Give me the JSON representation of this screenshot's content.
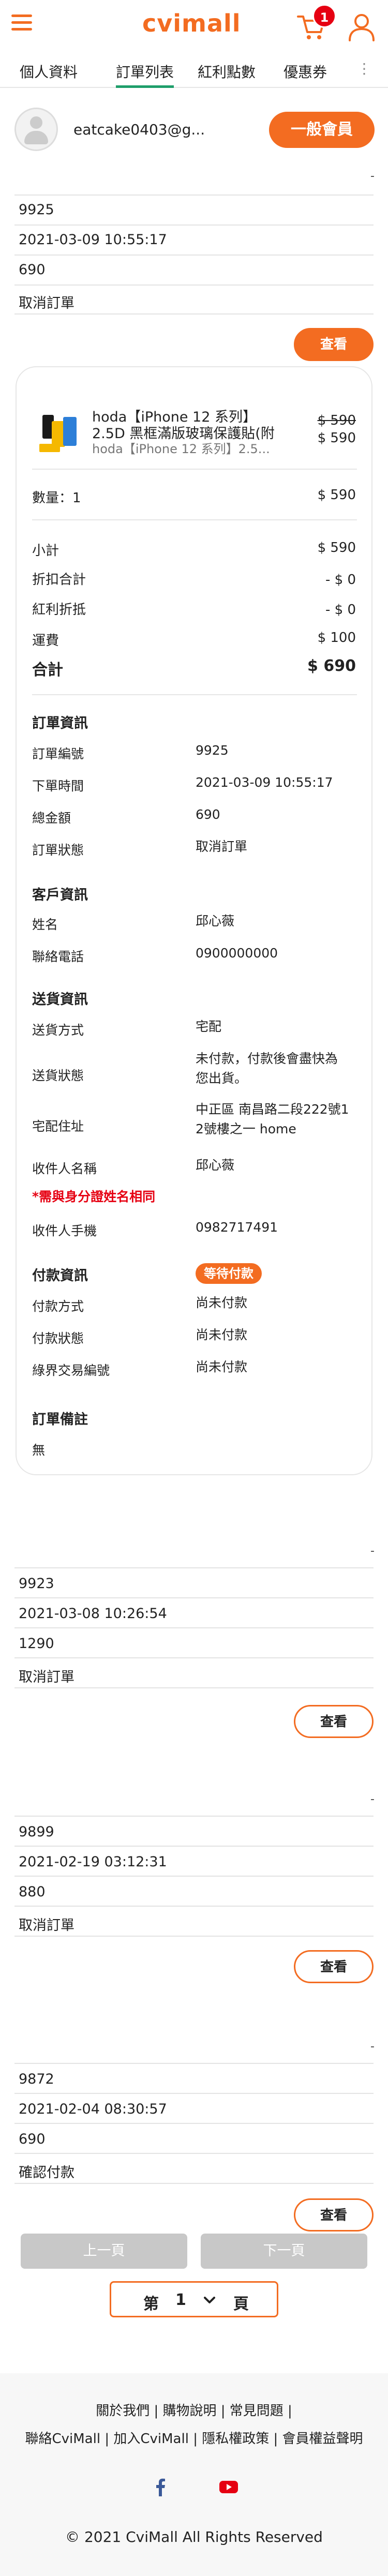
{
  "header": {
    "logo": "cvimall",
    "cart_count": "1"
  },
  "tabs": {
    "items": [
      "個人資料",
      "訂單列表",
      "紅利點數",
      "優惠券"
    ],
    "more": "⋮"
  },
  "user": {
    "email": "eatcake0403@g...",
    "member_level": "一般會員"
  },
  "orders": [
    {
      "number": "9925",
      "time": "2021-03-09 10:55:17",
      "total": "690",
      "status": "取消訂單",
      "view_label": "查看"
    },
    {
      "number": "9923",
      "time": "2021-03-08 10:26:54",
      "total": "1290",
      "status": "取消訂單",
      "view_label": "查看"
    },
    {
      "number": "9899",
      "time": "2021-02-19 03:12:31",
      "total": "880",
      "status": "取消訂單",
      "view_label": "查看"
    },
    {
      "number": "9872",
      "time": "2021-02-04 08:30:57",
      "total": "690",
      "status": "確認付款",
      "view_label": "查看"
    }
  ],
  "order_row_dash": "-",
  "detail": {
    "product": {
      "name_line1": "hoda【iPhone 12 系列】",
      "name_line2": "2.5D 黑框滿版玻璃保護貼(附",
      "name_line3": "hoda【iPhone 12 系列】2.5...",
      "price_original": "$ 590",
      "price": "$ 590"
    },
    "quantity_label": "數量：1",
    "quantity_amount": "$ 590",
    "summary": {
      "subtotal_label": "小計",
      "subtotal": "$ 590",
      "discount_label": "折扣合計",
      "discount": "- $ 0",
      "bonus_label": "紅利折抵",
      "bonus": "- $ 0",
      "shipping_label": "運費",
      "shipping": "$ 100",
      "total_label": "合計",
      "total": "$ 690"
    },
    "order_info": {
      "title": "訂單資訊",
      "number_label": "訂單編號",
      "number": "9925",
      "time_label": "下單時間",
      "time": "2021-03-09 10:55:17",
      "amount_label": "總金額",
      "amount": "690",
      "status_label": "訂單狀態",
      "status": "取消訂單"
    },
    "customer_info": {
      "title": "客戶資訊",
      "name_label": "姓名",
      "name": "邱心薇",
      "phone_label": "聯絡電話",
      "phone": "0900000000"
    },
    "delivery_info": {
      "title": "送貨資訊",
      "method_label": "送貨方式",
      "method": "宅配",
      "status_label": "送貨狀態",
      "status_line1": "未付款，付款後會盡快為",
      "status_line2": "您出貨。",
      "address_label": "宅配住址",
      "address_line1": "中正區 南昌路二段222號1",
      "address_line2": "2號樓之一 home",
      "recipient_label": "收件人名稱",
      "recipient": "邱心薇",
      "warning": "*需與身分證姓名相同",
      "recipient_phone_label": "收件人手機",
      "recipient_phone": "0982717491"
    },
    "payment_info": {
      "title": "付款資訊",
      "badge": "等待付款",
      "method_label": "付款方式",
      "method": "尚未付款",
      "status_label": "付款狀態",
      "status": "尚未付款",
      "txn_label": "綠界交易編號",
      "txn": "尚未付款"
    },
    "remark": {
      "title": "訂單備註",
      "value": "無"
    }
  },
  "pagination": {
    "prev": "上一頁",
    "next": "下一頁",
    "prefix": "第",
    "page": "1",
    "suffix": "頁"
  },
  "footer": {
    "line1": "關於我們 | 購物說明 | 常見問題 |",
    "line2": "聯絡CviMall | 加入CviMall | 隱私權政策 | 會員權益聲明",
    "copyright": "© 2021 CviMall All Rights Reserved"
  },
  "colors": {
    "accent": "#f36c21",
    "tab_active": "#1e9e6a",
    "badge": "#e60012",
    "warning": "#e60012",
    "facebook": "#3b5998",
    "youtube": "#e60012"
  },
  "icons": [
    "hamburger-menu-icon",
    "cart-icon",
    "user-icon",
    "avatar-icon",
    "chevron-down-icon",
    "facebook-icon",
    "youtube-icon"
  ]
}
